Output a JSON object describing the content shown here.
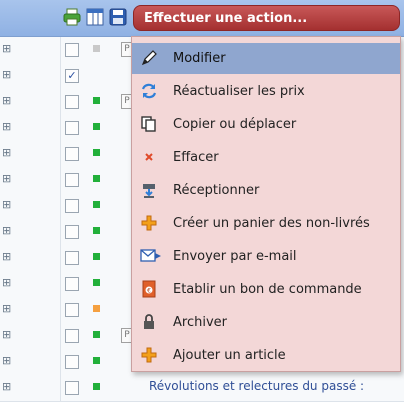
{
  "toolbar": {
    "action_button_label": "Effectuer une action..."
  },
  "grid": {
    "visible_row_text": "Révolutions et relectures du passé :"
  },
  "menu": {
    "items": [
      {
        "label": "Modifier",
        "icon": "pencil-icon",
        "active": true
      },
      {
        "label": "Réactualiser les prix",
        "icon": "refresh-icon"
      },
      {
        "label": "Copier ou déplacer",
        "icon": "copy-icon"
      },
      {
        "label": "Effacer",
        "icon": "delete-x-icon"
      },
      {
        "label": "Réceptionner",
        "icon": "receive-icon"
      },
      {
        "label": "Créer un panier des non-livrés",
        "icon": "add-basket-icon"
      },
      {
        "label": "Envoyer par e-mail",
        "icon": "email-icon"
      },
      {
        "label": "Etablir un bon de commande",
        "icon": "order-form-icon"
      },
      {
        "label": "Archiver",
        "icon": "lock-icon"
      },
      {
        "label": "Ajouter un article",
        "icon": "add-article-icon"
      }
    ]
  },
  "colors": {
    "action_button": "#a43030",
    "menu_background": "#f3d7d7",
    "menu_highlight": "#8fa6cf",
    "toolbar": "#8fb1e3",
    "status_green": "#22b03a",
    "status_orange": "#f5a040",
    "status_gray": "#c9c9c9"
  }
}
